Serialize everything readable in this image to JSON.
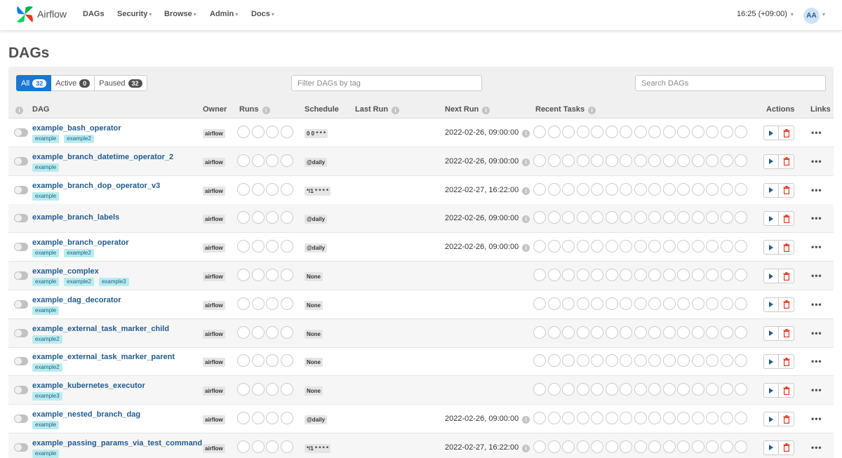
{
  "nav": {
    "brand": "Airflow",
    "items": [
      {
        "label": "DAGs",
        "dropdown": false
      },
      {
        "label": "Security",
        "dropdown": true
      },
      {
        "label": "Browse",
        "dropdown": true
      },
      {
        "label": "Admin",
        "dropdown": true
      },
      {
        "label": "Docs",
        "dropdown": true
      }
    ],
    "time": "16:25 (+09:00)",
    "user_initials": "AA"
  },
  "page": {
    "title": "DAGs"
  },
  "filters": {
    "status": [
      {
        "label": "All",
        "count": "32"
      },
      {
        "label": "Active",
        "count": "0"
      },
      {
        "label": "Paused",
        "count": "32"
      }
    ],
    "tag_placeholder": "Filter DAGs by tag",
    "search_placeholder": "Search DAGs"
  },
  "columns": {
    "dag": "DAG",
    "owner": "Owner",
    "runs": "Runs",
    "schedule": "Schedule",
    "last_run": "Last Run",
    "next_run": "Next Run",
    "recent_tasks": "Recent Tasks",
    "actions": "Actions",
    "links": "Links"
  },
  "dags": [
    {
      "name": "example_bash_operator",
      "tags": [
        "example",
        "example2"
      ],
      "owner": "airflow",
      "schedule": "0 0 * * *",
      "next_run": "2022-02-26, 09:00:00"
    },
    {
      "name": "example_branch_datetime_operator_2",
      "tags": [
        "example"
      ],
      "owner": "airflow",
      "schedule": "@daily",
      "next_run": "2022-02-26, 09:00:00"
    },
    {
      "name": "example_branch_dop_operator_v3",
      "tags": [
        "example"
      ],
      "owner": "airflow",
      "schedule": "*/1 * * * *",
      "next_run": "2022-02-27, 16:22:00"
    },
    {
      "name": "example_branch_labels",
      "tags": [],
      "owner": "airflow",
      "schedule": "@daily",
      "next_run": "2022-02-26, 09:00:00"
    },
    {
      "name": "example_branch_operator",
      "tags": [
        "example",
        "example2"
      ],
      "owner": "airflow",
      "schedule": "@daily",
      "next_run": "2022-02-26, 09:00:00"
    },
    {
      "name": "example_complex",
      "tags": [
        "example",
        "example2",
        "example3"
      ],
      "owner": "airflow",
      "schedule": "None",
      "next_run": ""
    },
    {
      "name": "example_dag_decorator",
      "tags": [
        "example"
      ],
      "owner": "airflow",
      "schedule": "None",
      "next_run": ""
    },
    {
      "name": "example_external_task_marker_child",
      "tags": [
        "example2"
      ],
      "owner": "airflow",
      "schedule": "None",
      "next_run": ""
    },
    {
      "name": "example_external_task_marker_parent",
      "tags": [
        "example2"
      ],
      "owner": "airflow",
      "schedule": "None",
      "next_run": ""
    },
    {
      "name": "example_kubernetes_executor",
      "tags": [
        "example3"
      ],
      "owner": "airflow",
      "schedule": "None",
      "next_run": ""
    },
    {
      "name": "example_nested_branch_dag",
      "tags": [
        "example"
      ],
      "owner": "airflow",
      "schedule": "@daily",
      "next_run": "2022-02-26, 09:00:00"
    },
    {
      "name": "example_passing_params_via_test_command",
      "tags": [
        "example"
      ],
      "owner": "airflow",
      "schedule": "*/1 * * * *",
      "next_run": "2022-02-27, 16:22:00"
    }
  ],
  "colors": {
    "accent": "#1976d2",
    "link": "#1f5b8f",
    "tag": "#b8ecec",
    "delete": "#e43921"
  },
  "icons": {
    "logo": "airflow-pinwheel-icon",
    "info": "info-icon",
    "run": "play-icon",
    "delete": "trash-icon",
    "links": "more-dots-icon"
  }
}
